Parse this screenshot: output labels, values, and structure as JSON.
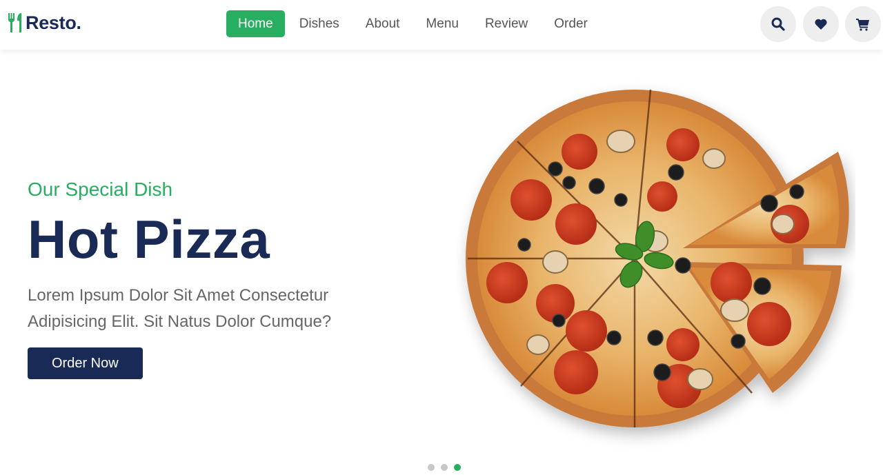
{
  "header": {
    "logo_text": "Resto.",
    "nav": [
      {
        "label": "Home",
        "active": true
      },
      {
        "label": "Dishes",
        "active": false
      },
      {
        "label": "About",
        "active": false
      },
      {
        "label": "Menu",
        "active": false
      },
      {
        "label": "Review",
        "active": false
      },
      {
        "label": "Order",
        "active": false
      }
    ],
    "icons": [
      "search-icon",
      "heart-icon",
      "cart-icon"
    ]
  },
  "hero": {
    "subtitle": "Our Special Dish",
    "title": "Hot Pizza",
    "description": "Lorem Ipsum Dolor Sit Amet Consectetur Adipisicing Elit. Sit Natus Dolor Cumque?",
    "button_label": "Order Now"
  },
  "slider": {
    "total": 3,
    "active_index": 2
  },
  "colors": {
    "accent": "#27ae60",
    "primary": "#192a56",
    "icon_bg": "#eeeeee"
  }
}
